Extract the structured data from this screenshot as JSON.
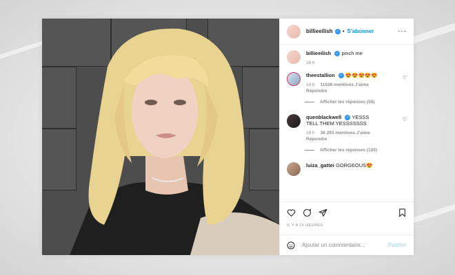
{
  "post": {
    "username": "billieeilish",
    "follow_label": "S'abonner",
    "caption": "pinch me",
    "caption_time": "16 h",
    "timestamp": "IL Y A 16 HEURES"
  },
  "comments": [
    {
      "username": "theestallion",
      "text": "😍😍😍😍😍",
      "time": "14 h",
      "likes": "11526 mentions J'aime",
      "reply_label": "Répondre",
      "view_replies": "Afficher les réponses (55)"
    },
    {
      "username": "quenblackwell",
      "text": "YESSS TELL THEM YESSSSSSS",
      "time": "16 h",
      "likes": "36 293 mentions J'aime",
      "reply_label": "Répondre",
      "view_replies": "Afficher les réponses (120)"
    },
    {
      "username": "luiza_gattei",
      "text": "GORGEOUS😍"
    }
  ],
  "add_comment": {
    "placeholder": "Ajouter un commentaire...",
    "publish_label": "Publier"
  },
  "colors": {
    "link": "#0095f6",
    "verified": "#3897f0",
    "muted": "#8e8e8e"
  }
}
